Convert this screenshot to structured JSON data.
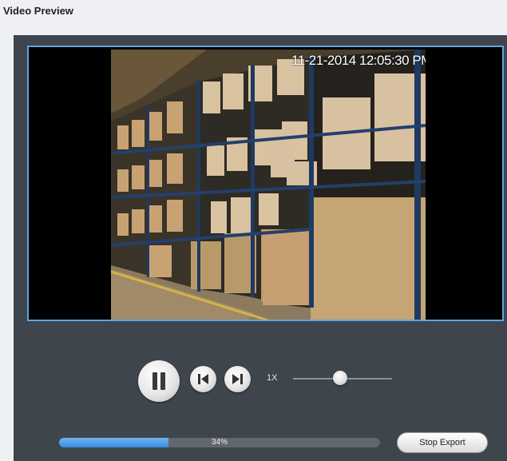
{
  "window": {
    "title": "Video Preview"
  },
  "video": {
    "timestamp": "11-21-2014 12:05:30 PM"
  },
  "controls": {
    "pause_icon": "pause-icon",
    "step_back_icon": "step-back-icon",
    "step_forward_icon": "step-forward-icon",
    "speed_label": "1X",
    "speed_level": 0.5
  },
  "export": {
    "progress_percent": 34,
    "progress_label": "34%",
    "stop_label": "Stop Export"
  },
  "colors": {
    "accent": "#3d8de0",
    "panel": "#3f454c",
    "frame_border": "#5aa7e0"
  }
}
